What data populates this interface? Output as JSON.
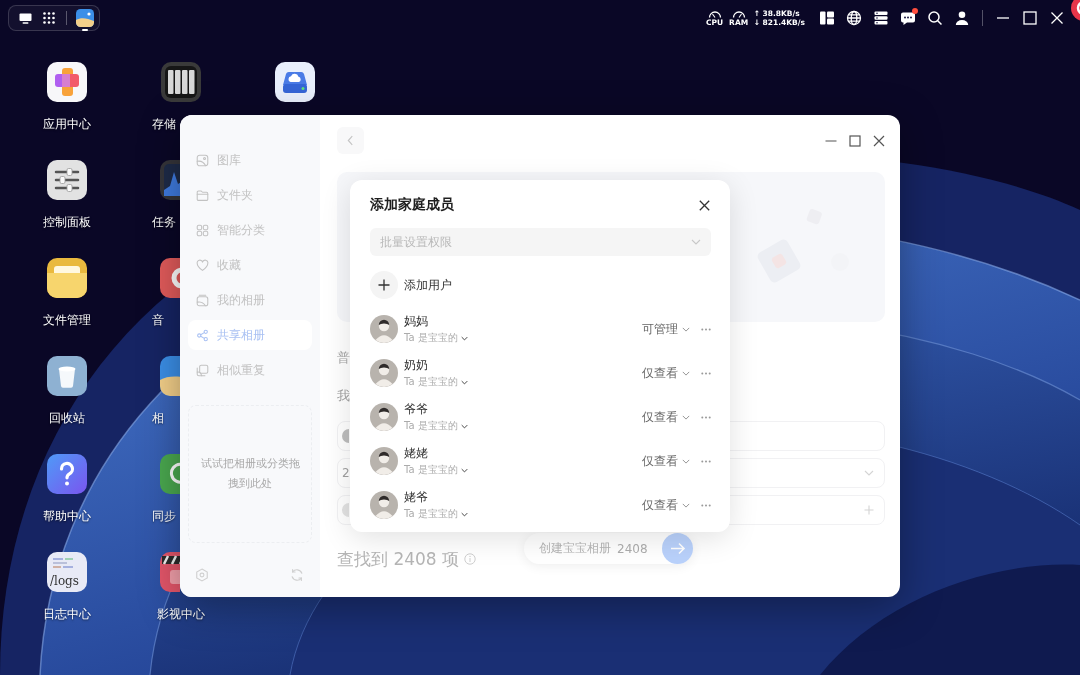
{
  "top_bar": {
    "cpu_label": "CPU",
    "ram_label": "RAM",
    "upload": "↑ 38.8KB/s",
    "download": "↓ 821.4KB/s",
    "messages_unread": true
  },
  "desktop": {
    "columns": [
      [
        {
          "kind": "appcenter",
          "label": "应用中心"
        },
        {
          "kind": "controls",
          "label": "控制面板"
        },
        {
          "kind": "folder",
          "label": "文件管理"
        },
        {
          "kind": "trash",
          "label": "回收站"
        },
        {
          "kind": "help",
          "label": "帮助中心"
        },
        {
          "kind": "logs",
          "label": "日志中心",
          "icon_text": "/logs"
        }
      ],
      [
        {
          "kind": "storage",
          "label": "存储"
        },
        {
          "kind": "monitor",
          "label": "任务"
        },
        {
          "kind": "music",
          "label": "音"
        },
        {
          "kind": "photos",
          "label": "相"
        },
        {
          "kind": "sync",
          "label": "同步"
        },
        {
          "kind": "video",
          "label": "影视中心"
        }
      ],
      [
        {
          "kind": "cloud"
        }
      ]
    ]
  },
  "window": {
    "sidebar": {
      "items": [
        {
          "kind": "gallery",
          "label": "图库",
          "selected": false
        },
        {
          "kind": "folder",
          "label": "文件夹",
          "selected": false
        },
        {
          "kind": "smart",
          "label": "智能分类",
          "selected": false
        },
        {
          "kind": "favorite",
          "label": "收藏",
          "selected": false
        },
        {
          "kind": "album",
          "label": "我的相册",
          "selected": false
        },
        {
          "kind": "shared",
          "label": "共享相册",
          "selected": true
        },
        {
          "kind": "similar",
          "label": "相似重复",
          "selected": false
        }
      ],
      "drop_hint": "试试把相册或分类拖拽到此处"
    },
    "main": {
      "heading_1": "普",
      "heading_2": "我",
      "rows": [
        {
          "kind": "avatar"
        },
        {
          "kind": "select",
          "text": "2"
        },
        {
          "kind": "add"
        }
      ],
      "result_count": "查找到 2408 项",
      "create_button": {
        "label": "创建宝宝相册",
        "count": "2408"
      }
    }
  },
  "dialog": {
    "title": "添加家庭成员",
    "batch_permission": {
      "placeholder": "批量设置权限"
    },
    "add_user": "添加用户",
    "members": [
      {
        "name": "妈妈",
        "relation": "Ta 是宝宝的",
        "permission": "可管理"
      },
      {
        "name": "奶奶",
        "relation": "Ta 是宝宝的",
        "permission": "仅查看"
      },
      {
        "name": "爷爷",
        "relation": "Ta 是宝宝的",
        "permission": "仅查看"
      },
      {
        "name": "姥姥",
        "relation": "Ta 是宝宝的",
        "permission": "仅查看"
      },
      {
        "name": "姥爷",
        "relation": "Ta 是宝宝的",
        "permission": "仅查看"
      }
    ]
  }
}
